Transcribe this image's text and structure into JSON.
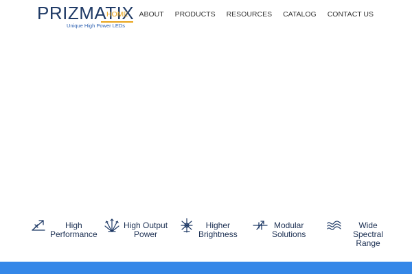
{
  "brand": {
    "name": "PRIZMATIX",
    "tagline": "Unique High Power LEDs"
  },
  "nav": {
    "items": [
      {
        "label": "HOME",
        "active": true
      },
      {
        "label": "ABOUT",
        "active": false
      },
      {
        "label": "PRODUCTS",
        "active": false
      },
      {
        "label": "RESOURCES",
        "active": false
      },
      {
        "label": "CATALOG",
        "active": false
      },
      {
        "label": "CONTACT US",
        "active": false
      }
    ]
  },
  "features": [
    {
      "icon": "performance-arrow-icon",
      "lines": [
        "High",
        "Performance"
      ]
    },
    {
      "icon": "output-power-burst-icon",
      "lines": [
        "High Output",
        "Power"
      ]
    },
    {
      "icon": "brightness-star-icon",
      "lines": [
        "Higher",
        "Brightness"
      ]
    },
    {
      "icon": "modular-slider-icon",
      "lines": [
        "Modular",
        "Solutions"
      ]
    },
    {
      "icon": "spectral-waves-icon",
      "lines": [
        "Wide",
        "Spectral",
        "Range"
      ]
    }
  ],
  "colors": {
    "brand_navy": "#1f3a66",
    "tagline_blue": "#2b5fb0",
    "nav_active": "#e8a317",
    "nav_text": "#333333",
    "feature_text": "#1b2f52",
    "bottom_bar": "#3487e8"
  }
}
